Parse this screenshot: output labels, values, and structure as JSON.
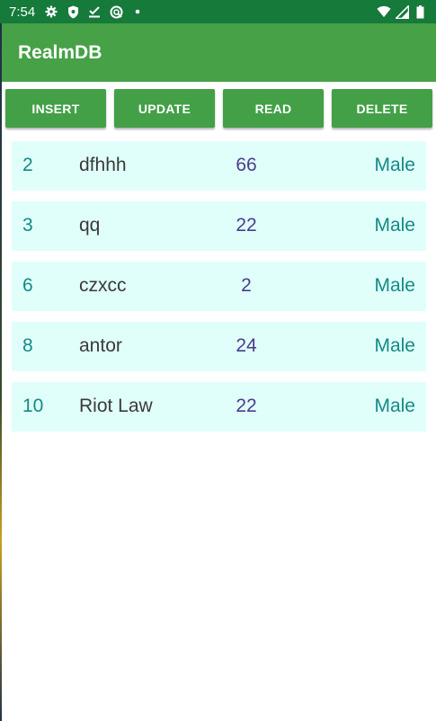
{
  "status": {
    "time": "7:54",
    "left_icons": [
      "gear-icon",
      "shield-icon",
      "download-check-icon",
      "sync-icon",
      "dot-icon"
    ],
    "right_icons": [
      "wifi-icon",
      "signal-icon",
      "battery-icon"
    ]
  },
  "appbar": {
    "title": "RealmDB",
    "color": "#46a147"
  },
  "buttons": {
    "insert": "INSERT",
    "update": "UPDATE",
    "read": "READ",
    "delete": "DELETE",
    "color": "#43a047"
  },
  "rows": [
    {
      "id": "2",
      "name": "dfhhh",
      "age": "66",
      "gender": "Male"
    },
    {
      "id": "3",
      "name": "qq",
      "age": "22",
      "gender": "Male"
    },
    {
      "id": "6",
      "name": "czxcc",
      "age": "2",
      "gender": "Male"
    },
    {
      "id": "8",
      "name": "antor",
      "age": "24",
      "gender": "Male"
    },
    {
      "id": "10",
      "name": "Riot Law",
      "age": "22",
      "gender": "Male"
    }
  ]
}
